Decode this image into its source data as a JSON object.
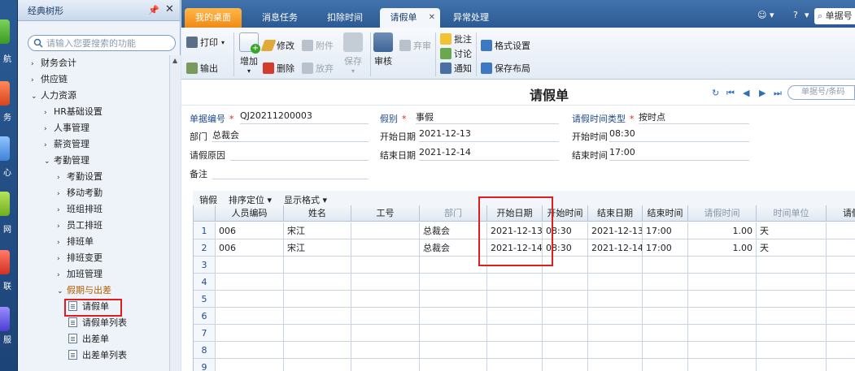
{
  "left_strip": {
    "labels": [
      "航",
      "务",
      "心",
      "网",
      "联",
      "服"
    ]
  },
  "tree": {
    "title": "经典树形",
    "search_placeholder": "请输入您要搜索的功能",
    "items": [
      {
        "label": "财务会计",
        "arrow": "›"
      },
      {
        "label": "供应链",
        "arrow": "›"
      },
      {
        "label": "人力资源",
        "arrow": "⌄"
      },
      {
        "label": "HR基础设置",
        "arrow": "›"
      },
      {
        "label": "人事管理",
        "arrow": "›"
      },
      {
        "label": "薪资管理",
        "arrow": "›"
      },
      {
        "label": "考勤管理",
        "arrow": "⌄"
      },
      {
        "label": "考勤设置",
        "arrow": "›"
      },
      {
        "label": "移动考勤",
        "arrow": "›"
      },
      {
        "label": "班组排班",
        "arrow": "›"
      },
      {
        "label": "员工排班",
        "arrow": "›"
      },
      {
        "label": "排班单",
        "arrow": "›"
      },
      {
        "label": "排班变更",
        "arrow": "›"
      },
      {
        "label": "加班管理",
        "arrow": "›"
      },
      {
        "label": "假期与出差",
        "arrow": "⌄"
      },
      {
        "label": "请假单",
        "arrow": ""
      },
      {
        "label": "请假单列表",
        "arrow": ""
      },
      {
        "label": "出差单",
        "arrow": ""
      },
      {
        "label": "出差单列表",
        "arrow": ""
      }
    ]
  },
  "tabs": [
    "我的桌面",
    "消息任务",
    "扣除时间",
    "请假单",
    "异常处理"
  ],
  "top_search": "单据号",
  "toolbar": {
    "print": "打印",
    "output": "输出",
    "add": "增加",
    "modify": "修改",
    "attach": "附件",
    "delete": "删除",
    "abandon": "放弃",
    "save": "保存",
    "audit": "审核",
    "reject": "弃审",
    "comment": "批注",
    "discuss": "讨论",
    "notify": "通知",
    "format": "格式设置",
    "layout": "保存布局"
  },
  "form": {
    "title": "请假单",
    "search_placeholder": "单据号/条码",
    "labels": {
      "doc_no": "单据编号",
      "type": "假别",
      "time_type": "请假时间类型",
      "dept": "部门",
      "start_date": "开始日期",
      "start_time": "开始时间",
      "reason": "请假原因",
      "end_date": "结束日期",
      "end_time": "结束时间",
      "remark": "备注"
    },
    "values": {
      "doc_no": "QJ20211200003",
      "type": "事假",
      "time_type": "按时点",
      "dept": "总裁会",
      "start_date": "2021-12-13",
      "start_time": "08:30",
      "reason": "",
      "end_date": "2021-12-14",
      "end_time": "17:00",
      "remark": ""
    }
  },
  "grid": {
    "toolbar": [
      "销假",
      "排序定位",
      "显示格式"
    ],
    "columns": [
      "人员编码",
      "姓名",
      "工号",
      "部门",
      "开始日期",
      "开始时间",
      "结束日期",
      "结束时间",
      "请假时间",
      "时间单位",
      "请假"
    ],
    "rows": [
      [
        "006",
        "宋江",
        "",
        "总裁会",
        "2021-12-13",
        "08:30",
        "2021-12-13",
        "17:00",
        "1.00",
        "天",
        ""
      ],
      [
        "006",
        "宋江",
        "",
        "总裁会",
        "2021-12-14",
        "08:30",
        "2021-12-14",
        "17:00",
        "1.00",
        "天",
        ""
      ]
    ],
    "row_numbers": [
      "1",
      "2",
      "3",
      "4",
      "5",
      "6",
      "7",
      "8",
      "9"
    ]
  }
}
